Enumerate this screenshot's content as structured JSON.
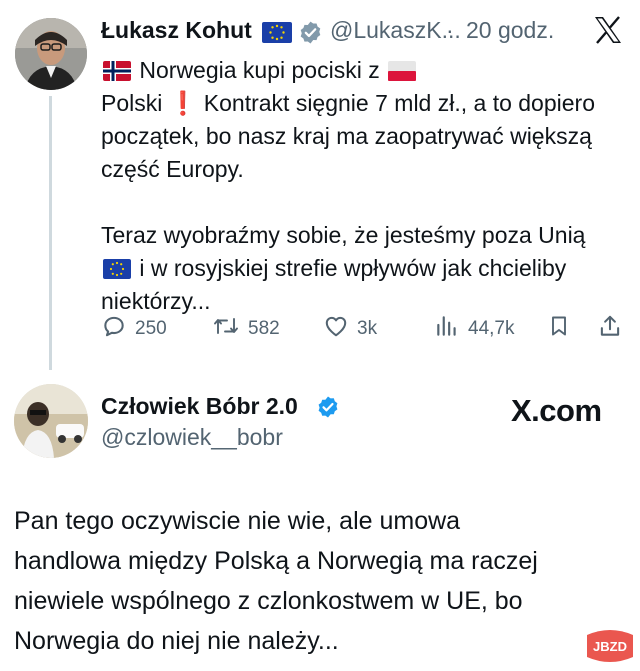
{
  "tweet": {
    "author_name": "Łukasz Kohut",
    "author_handle": "@LukaszK...",
    "separator": "·",
    "time": "20 godz.",
    "body_lines": [
      {
        "pre": "",
        "flag_before": "norway-flag",
        "text": "Norwegia kupi pociski z",
        "flag_after": "poland-flag"
      },
      {
        "text": "Polski"
      },
      {
        "text": "Kontrakt sięgnie 7 mld zł., a to dopiero"
      },
      {
        "text": "początek, bo nasz kraj ma zaopatrywać większą"
      },
      {
        "text": "część Europy."
      },
      {
        "text": "Teraz wyobraźmy sobie, że jesteśmy poza Unią"
      },
      {
        "text": "i w rosyjskiej strefie wpływów jak chcieliby"
      },
      {
        "text": "niektórzy..."
      }
    ],
    "exclamation": "❗",
    "stats": {
      "replies": "250",
      "reposts": "582",
      "likes": "3k",
      "views": "44,7k"
    }
  },
  "reply": {
    "author_name": "Człowiek Bóbr 2.0",
    "author_handle": "@czlowiek__bobr",
    "source_label": "X.com",
    "body_lines": [
      "Pan tego oczywiscie nie wie, ale umowa",
      "handlowa między Polską a Norwegią ma raczej",
      "niewiele wspólnego z czlonkostwem w UE, bo",
      "Norwegia do niej nie należy..."
    ]
  },
  "watermark": "JBZD",
  "icons": [
    "eu-flag-icon",
    "verified-badge-icon",
    "x-logo-icon",
    "norway-flag-icon",
    "poland-flag-icon",
    "reply-icon",
    "repost-icon",
    "like-icon",
    "views-icon",
    "bookmark-icon",
    "share-icon"
  ],
  "colors": {
    "text": "#0f1419",
    "secondary": "#536471",
    "verified_blue": "#1d9bf0",
    "verified_gray": "#829aab",
    "thread_line": "#cfd9de",
    "watermark": "#e8453c"
  }
}
